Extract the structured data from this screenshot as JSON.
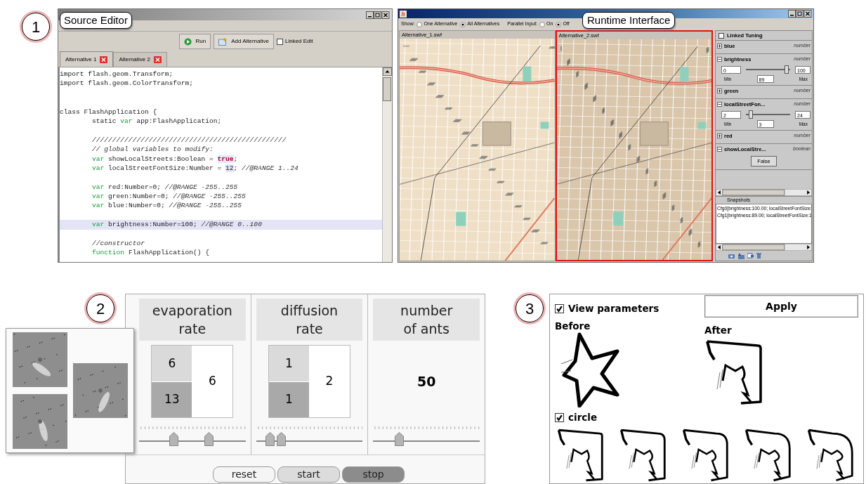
{
  "panel_1": {
    "badge": "1",
    "source_editor": {
      "callout": "Source Editor",
      "toolbar": [
        {
          "kind": "run",
          "label": "Run"
        },
        {
          "kind": "add",
          "label": "Add Alternative"
        }
      ],
      "linked_edit": {
        "label": "Linked Edit",
        "checked": false
      },
      "tabs": [
        {
          "label": "Alternative 1",
          "selected": true
        },
        {
          "label": "Alternative 2",
          "selected": false
        }
      ],
      "code_lines": [
        {
          "kind": "code",
          "highlighted": false,
          "tokens": [
            {
              "kind": "plain",
              "text": "import flash.geom.Transform;"
            }
          ]
        },
        {
          "kind": "code",
          "highlighted": false,
          "tokens": [
            {
              "kind": "plain",
              "text": "import flash.geom.ColorTransform;"
            }
          ]
        },
        {
          "kind": "blank"
        },
        {
          "kind": "blank"
        },
        {
          "kind": "code",
          "highlighted": false,
          "tokens": [
            {
              "kind": "plain",
              "text": "class FlashApplication {"
            }
          ]
        },
        {
          "kind": "code",
          "highlighted": false,
          "tokens": [
            {
              "kind": "plain",
              "text": "        static "
            },
            {
              "kind": "keyword",
              "text": "var"
            },
            {
              "kind": "plain",
              "text": " app:FlashApplication;"
            }
          ]
        },
        {
          "kind": "blank"
        },
        {
          "kind": "code",
          "highlighted": false,
          "tokens": [
            {
              "kind": "comment",
              "text": "        ////////////////////////////////////////////////"
            }
          ]
        },
        {
          "kind": "code",
          "highlighted": false,
          "tokens": [
            {
              "kind": "comment",
              "text": "        // global variables to modify:"
            }
          ]
        },
        {
          "kind": "code",
          "highlighted": false,
          "tokens": [
            {
              "kind": "keyword",
              "text": "        var"
            },
            {
              "kind": "plain",
              "text": " showLocalStreets:Boolean = "
            },
            {
              "kind": "literal",
              "text": "true"
            },
            {
              "kind": "plain",
              "text": ";"
            }
          ]
        },
        {
          "kind": "code",
          "highlighted": false,
          "tokens": [
            {
              "kind": "keyword",
              "text": "        var"
            },
            {
              "kind": "plain",
              "text": " localStreetFontSize:Number = "
            },
            {
              "kind": "number",
              "text": "12"
            },
            {
              "kind": "plain",
              "text": "; "
            },
            {
              "kind": "comment",
              "text": "//@RANGE 1..24"
            }
          ]
        },
        {
          "kind": "blank"
        },
        {
          "kind": "code",
          "highlighted": false,
          "tokens": [
            {
              "kind": "keyword",
              "text": "        var"
            },
            {
              "kind": "plain",
              "text": " red:Number=0; "
            },
            {
              "kind": "comment",
              "text": "//@RANGE -255..255"
            }
          ]
        },
        {
          "kind": "code",
          "highlighted": false,
          "tokens": [
            {
              "kind": "keyword",
              "text": "        var"
            },
            {
              "kind": "plain",
              "text": " green:Number=0; "
            },
            {
              "kind": "comment",
              "text": "//@RANGE -255..255"
            }
          ]
        },
        {
          "kind": "code",
          "highlighted": false,
          "tokens": [
            {
              "kind": "keyword",
              "text": "        var"
            },
            {
              "kind": "plain",
              "text": " blue:Number=0; "
            },
            {
              "kind": "comment",
              "text": "//@RANGE -255..255"
            }
          ]
        },
        {
          "kind": "blank"
        },
        {
          "kind": "code",
          "highlighted": true,
          "tokens": [
            {
              "kind": "keyword",
              "text": "        var"
            },
            {
              "kind": "plain",
              "text": " brightness:Number=100; "
            },
            {
              "kind": "comment",
              "text": "//@RANGE 0..100"
            }
          ]
        },
        {
          "kind": "blank"
        },
        {
          "kind": "code",
          "highlighted": false,
          "tokens": [
            {
              "kind": "comment",
              "text": "        //constructor"
            }
          ]
        },
        {
          "kind": "code",
          "highlighted": false,
          "tokens": [
            {
              "kind": "keyword",
              "text": "        function"
            },
            {
              "kind": "plain",
              "text": " FlashApplication() {"
            }
          ]
        }
      ]
    },
    "runtime_interface": {
      "callout": "Runtime Interface",
      "show_label": "Show:",
      "show_options": [
        {
          "label": "One Alternative",
          "selected": false
        },
        {
          "label": "All Alternatives",
          "selected": true
        }
      ],
      "parallel_label": "Parallel Input:",
      "parallel_options": [
        {
          "label": "On",
          "selected": false
        },
        {
          "label": "Off",
          "selected": true
        }
      ],
      "alternatives": [
        {
          "title": "Alternative_1.swf",
          "selected": false
        },
        {
          "title": "Alternative_2.swf",
          "selected": true
        }
      ],
      "linked_tuning": {
        "label": "Linked Tuning",
        "checked": false
      },
      "parameters": [
        {
          "name": "blue",
          "type": "number",
          "expanded": false
        },
        {
          "name": "brightness",
          "type": "number",
          "expanded": true,
          "kind": "slider",
          "min": "0",
          "max": "100",
          "value": "89",
          "min_label": "Min",
          "max_label": "Max",
          "level": 0.88
        },
        {
          "name": "green",
          "type": "number",
          "expanded": false
        },
        {
          "name": "localStreetFon...",
          "type": "number",
          "expanded": true,
          "kind": "slider",
          "min": "2",
          "max": "24",
          "value": "3",
          "min_label": "Min",
          "max_label": "Max",
          "level": 0.15
        },
        {
          "name": "red",
          "type": "number",
          "expanded": false
        },
        {
          "name": "showLocalStre...",
          "type": "boolean",
          "expanded": true,
          "kind": "toggle",
          "value": "False"
        }
      ],
      "snapshots": {
        "title": "Snapshots",
        "entries": [
          "Cfg0[brightness:100.00; localStreetFontSize:",
          "Cfg1[brightness:89.00; localStreetFontSize:1"
        ]
      }
    }
  },
  "panel_2": {
    "badge": "2",
    "parameters": [
      {
        "title": "evaporation\nrate",
        "kind": "pair",
        "cells": [
          "6",
          "13"
        ],
        "result": "6",
        "thumbs": [
          {
            "level": 0.32
          },
          {
            "level": 0.65
          }
        ]
      },
      {
        "title": "diffusion\nrate",
        "kind": "pair",
        "cells": [
          "1",
          "1"
        ],
        "result": "2",
        "thumbs": [
          {
            "level": 0.13
          },
          {
            "level": 0.23
          }
        ]
      },
      {
        "title": "number\nof ants",
        "kind": "single",
        "result": "50",
        "thumbs": [
          {
            "level": 0.24
          }
        ]
      }
    ],
    "buttons": [
      {
        "label": "reset",
        "color": "#f5f5f5"
      },
      {
        "label": "start",
        "color": "#dcdcdc"
      },
      {
        "label": "stop",
        "color": "#8c8c8c"
      }
    ]
  },
  "panel_3": {
    "badge": "3",
    "view_parameters": {
      "label": "View parameters",
      "checked": true
    },
    "apply": "Apply",
    "before": "Before",
    "after": "After",
    "circle": {
      "label": "circle",
      "checked": true
    }
  }
}
